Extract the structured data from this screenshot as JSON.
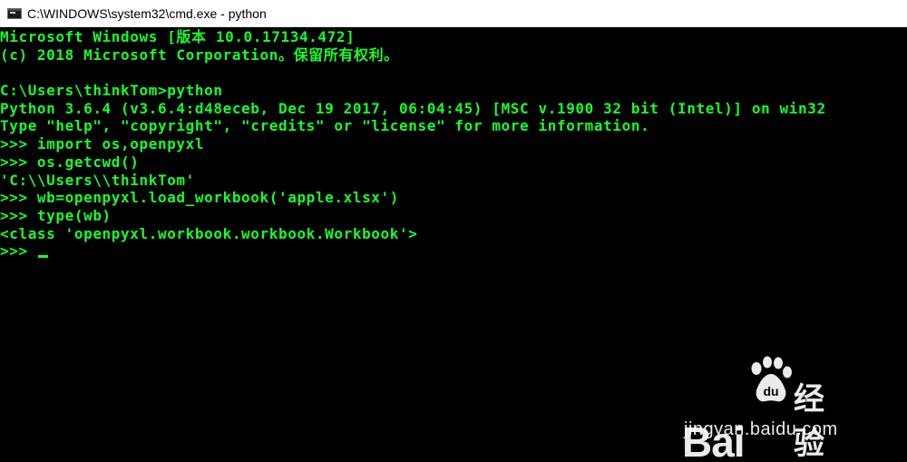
{
  "window": {
    "title": "C:\\WINDOWS\\system32\\cmd.exe - python",
    "icon": "cmd-console-icon"
  },
  "colors": {
    "console_text": "#16ff2c",
    "console_bg": "#000000",
    "titlebar_bg": "#ffffff"
  },
  "console": {
    "lines": [
      "Microsoft Windows [版本 10.0.17134.472]",
      "(c) 2018 Microsoft Corporation。保留所有权利。",
      "",
      "C:\\Users\\thinkTom>python",
      "Python 3.6.4 (v3.6.4:d48eceb, Dec 19 2017, 06:04:45) [MSC v.1900 32 bit (Intel)] on win32",
      "Type \"help\", \"copyright\", \"credits\" or \"license\" for more information.",
      ">>> import os,openpyxl",
      ">>> os.getcwd()",
      "'C:\\\\Users\\\\thinkTom'",
      ">>> wb=openpyxl.load_workbook('apple.xlsx')",
      ">>> type(wb)",
      "<class 'openpyxl.workbook.workbook.Workbook'>",
      ">>> "
    ]
  },
  "watermark": {
    "brand_latin": "Bai",
    "brand_cjk": "经验",
    "url": "jingyan.baidu.com",
    "icon": "baidu-paw-icon"
  }
}
